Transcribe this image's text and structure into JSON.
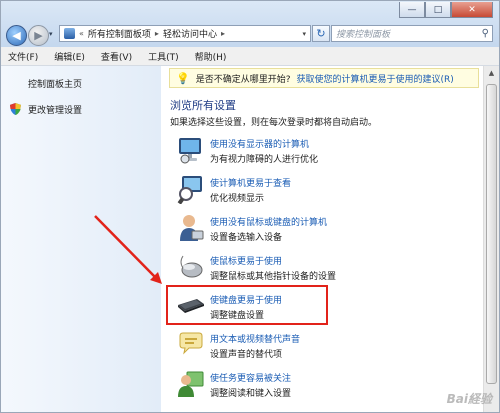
{
  "window": {
    "minimize": "—",
    "maximize": "□",
    "close": "✕"
  },
  "nav": {
    "back": "◀",
    "forward": "▶",
    "dropdown": "▾"
  },
  "address": {
    "prefix": "«",
    "crumbs": [
      "所有控制面板项",
      "轻松访问中心"
    ],
    "separator": "▸",
    "chevron": "▾"
  },
  "refresh_glyph": "↻",
  "search": {
    "placeholder": "搜索控制面板",
    "icon_glyph": "⚲"
  },
  "menu": [
    "文件(F)",
    "编辑(E)",
    "查看(V)",
    "工具(T)",
    "帮助(H)"
  ],
  "sidebar": {
    "home": "控制面板主页",
    "admin_settings": "更改管理设置"
  },
  "tip": {
    "question": "是否不确定从哪里开始?",
    "link": "获取使您的计算机更易于使用的建议(R)",
    "bulb_glyph": "💡"
  },
  "section": {
    "title": "浏览所有设置",
    "desc": "如果选择这些设置，则在每次登录时都将自动启动。"
  },
  "items": [
    {
      "title": "使用没有显示器的计算机",
      "desc": "为有视力障碍的人进行优化",
      "icon": "monitor-icon"
    },
    {
      "title": "使计算机更易于查看",
      "desc": "优化视频显示",
      "icon": "magnifier-icon"
    },
    {
      "title": "使用没有鼠标或键盘的计算机",
      "desc": "设置备选输入设备",
      "icon": "user-icon"
    },
    {
      "title": "使鼠标更易于使用",
      "desc": "调整鼠标或其他指针设备的设置",
      "icon": "mouse-icon"
    },
    {
      "title": "使键盘更易于使用",
      "desc": "调整键盘设置",
      "icon": "keyboard-icon"
    },
    {
      "title": "用文本或视频替代声音",
      "desc": "设置声音的替代项",
      "icon": "speech-bubble-icon"
    },
    {
      "title": "使任务更容易被关注",
      "desc": "调整阅读和键入设置",
      "icon": "people-icon"
    }
  ],
  "watermark": "Bai経验",
  "colors": {
    "link": "#1a5cb4",
    "section_title": "#1e3b84",
    "highlight": "#e2231a"
  }
}
